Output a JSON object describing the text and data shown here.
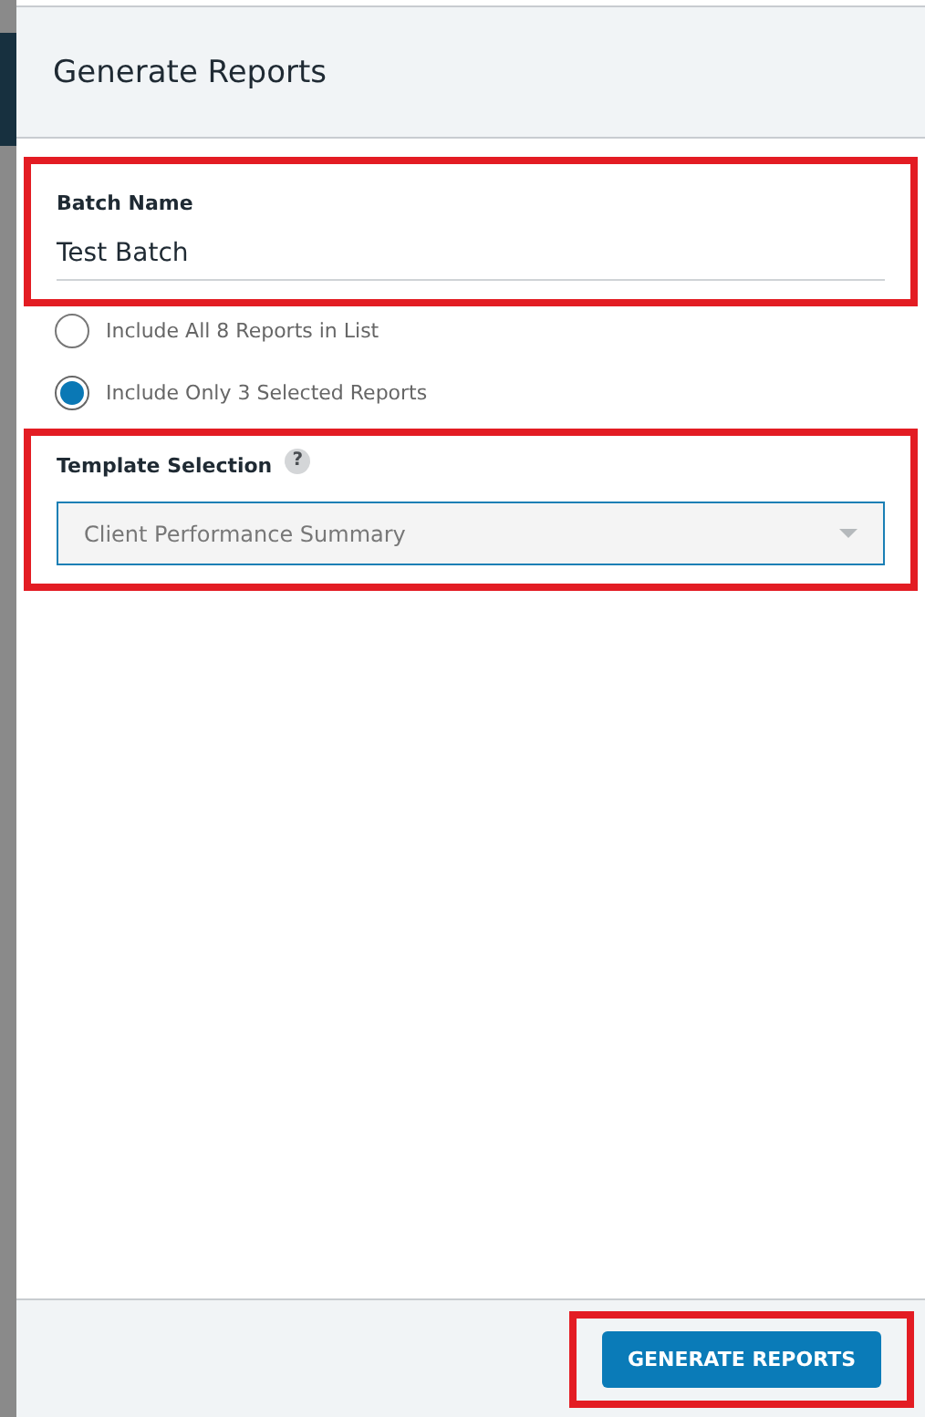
{
  "dialog": {
    "title": "Generate Reports"
  },
  "batch_name": {
    "label": "Batch Name",
    "value": "Test Batch",
    "highlighted": true
  },
  "scope_options": [
    {
      "label": "Include All 8 Reports in List",
      "selected": false
    },
    {
      "label": "Include Only 3 Selected Reports",
      "selected": true
    }
  ],
  "template_selection": {
    "label": "Template Selection",
    "help": "?",
    "value": "Client Performance Summary",
    "highlighted": true
  },
  "footer": {
    "button": "GENERATE REPORTS",
    "highlighted": true
  }
}
